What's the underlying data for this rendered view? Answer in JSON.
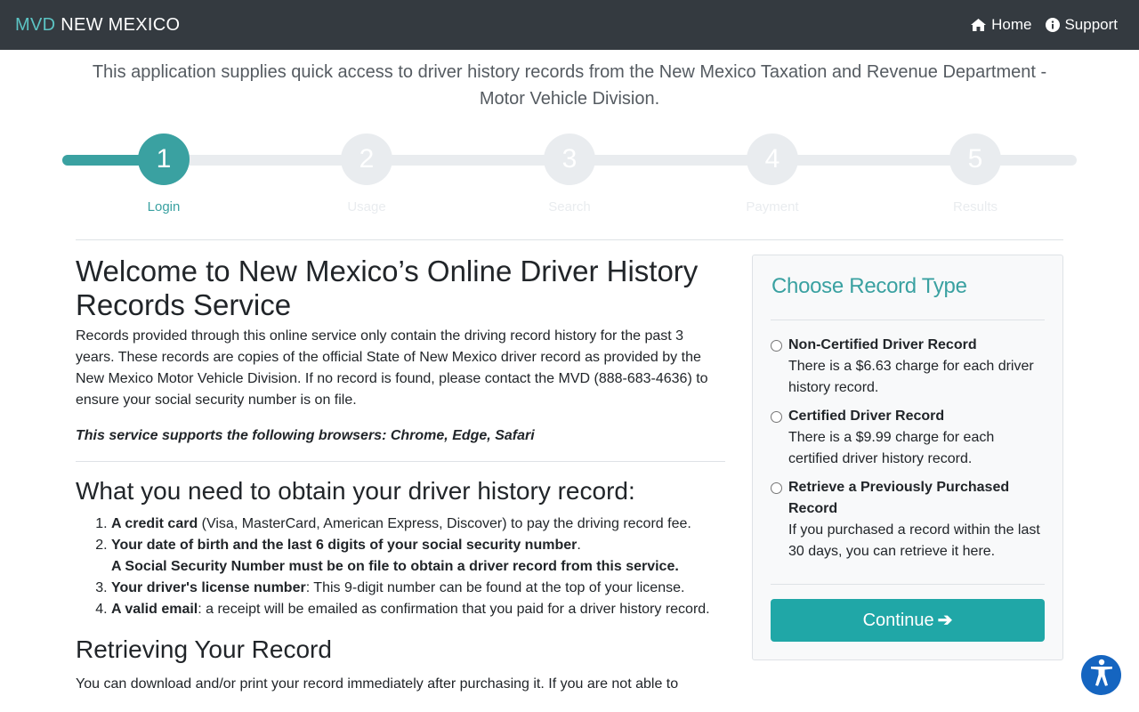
{
  "navbar": {
    "brand_accent": "MVD",
    "brand_rest": "NEW MEXICO",
    "home": "Home",
    "support": "Support"
  },
  "intro": "This application supplies quick access to driver history records from the New Mexico Taxation and Revenue Department - Motor Vehicle Division.",
  "stepper": {
    "steps": [
      {
        "num": "1",
        "label": "Login"
      },
      {
        "num": "2",
        "label": "Usage"
      },
      {
        "num": "3",
        "label": "Search"
      },
      {
        "num": "4",
        "label": "Payment"
      },
      {
        "num": "5",
        "label": "Results"
      }
    ],
    "active_step": 1
  },
  "welcome": {
    "title": "Welcome to New Mexico’s Online Driver History Records Service",
    "body": "Records provided through this online service only contain the driving record history for the past 3 years. These records are copies of the official State of New Mexico driver record as provided by the New Mexico Motor Vehicle Division. If no record is found, please contact the MVD (888-683-4636) to ensure your social security number is on file.",
    "browsers_note": "This service supports the following browsers: Chrome, Edge, Safari"
  },
  "requirements": {
    "title": "What you need to obtain your driver history record:",
    "items": [
      {
        "bold": "A credit card",
        "rest": " (Visa, MasterCard, American Express, Discover) to pay the driving record fee."
      },
      {
        "bold": "Your date of birth and the last 6 digits of your social security number",
        "rest": ".",
        "bold2": "A Social Security Number must be on file to obtain a driver record from this service."
      },
      {
        "bold": "Your driver's license number",
        "rest": ": This 9-digit number can be found at the top of your license."
      },
      {
        "bold": "A valid email",
        "rest": ": a receipt will be emailed as confirmation that you paid for a driver history record."
      }
    ]
  },
  "retrieving": {
    "title": "Retrieving Your Record",
    "body": "You can download and/or print your record immediately after purchasing it. If you are not able to"
  },
  "record_type": {
    "title": "Choose Record Type",
    "options": [
      {
        "title": "Non-Certified Driver Record",
        "desc": "There is a $6.63 charge for each driver history record."
      },
      {
        "title": "Certified Driver Record",
        "desc": "There is a $9.99 charge for each certified driver history record."
      },
      {
        "title": "Retrieve a Previously Purchased Record",
        "desc": "If you purchased a record within the last 30 days, you can retrieve it here."
      }
    ],
    "continue_label": "Continue",
    "continue_icon": "arrow-right-icon"
  },
  "colors": {
    "navbar": "#343a40",
    "accent": "#3aa1a1",
    "button": "#20a7a7",
    "accessibility": "#1565c0"
  },
  "icons": {
    "home": "home-icon",
    "support": "info-circle-icon",
    "accessibility": "accessibility-icon"
  }
}
